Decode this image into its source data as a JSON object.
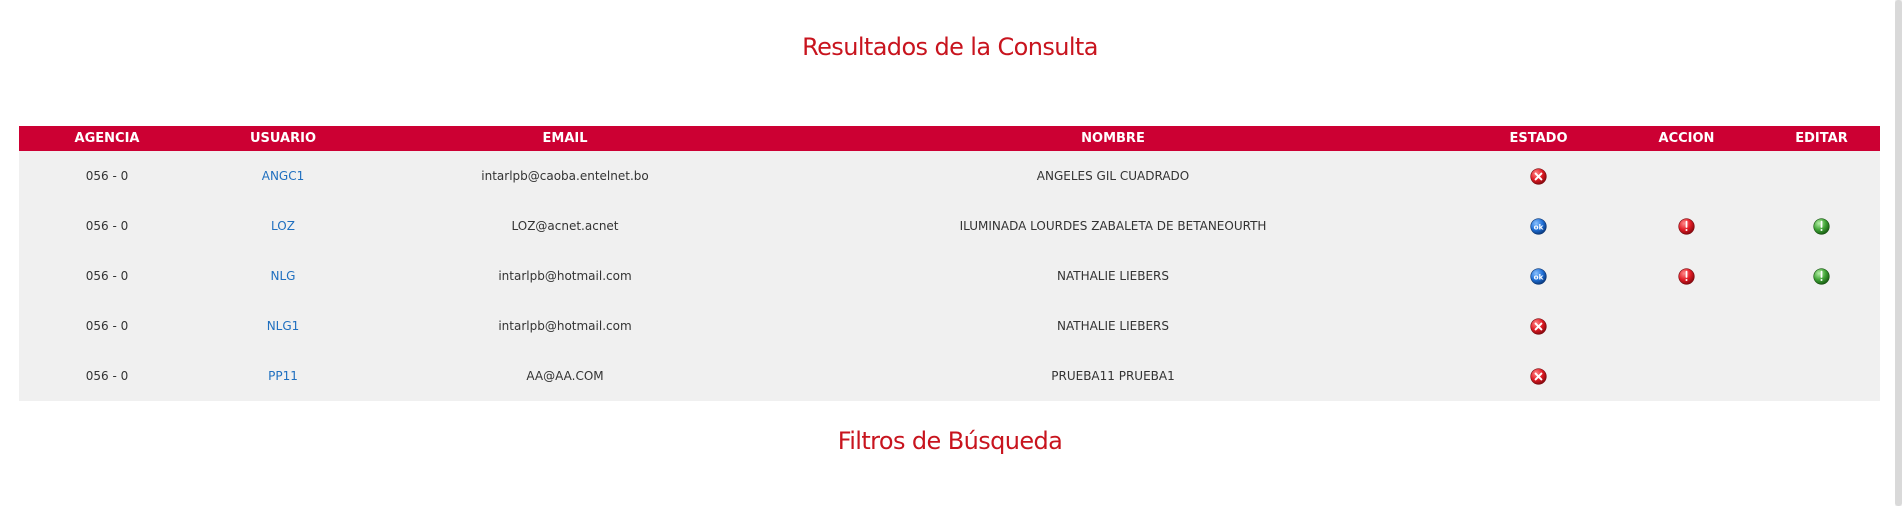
{
  "page": {
    "title": "Resultados de la Consulta",
    "filters_title": "Filtros de Búsqueda"
  },
  "colors": {
    "accent": "#cc0033",
    "title": "#c8141e",
    "link": "#1f6fbf",
    "row_bg": "#f0f0f0"
  },
  "table": {
    "headers": {
      "agencia": "AGENCIA",
      "usuario": "USUARIO",
      "email": "EMAIL",
      "nombre": "NOMBRE",
      "estado": "ESTADO",
      "accion": "ACCION",
      "editar": "EDITAR"
    },
    "rows": [
      {
        "agencia": "056 - 0",
        "usuario": "ANGC1",
        "email": "intarlpb@caoba.entelnet.bo",
        "nombre": "ANGELES GIL CUADRADO",
        "estado_icon": "inactive-x-icon",
        "accion_icon": "",
        "editar_icon": ""
      },
      {
        "agencia": "056 - 0",
        "usuario": "LOZ",
        "email": "LOZ@acnet.acnet",
        "nombre": "ILUMINADA LOURDES ZABALETA DE BETANEOURTH",
        "estado_icon": "ok-icon",
        "accion_icon": "power-off-icon",
        "editar_icon": "power-on-icon"
      },
      {
        "agencia": "056 - 0",
        "usuario": "NLG",
        "email": "intarlpb@hotmail.com",
        "nombre": "NATHALIE LIEBERS",
        "estado_icon": "ok-icon",
        "accion_icon": "power-off-icon",
        "editar_icon": "power-on-icon"
      },
      {
        "agencia": "056 - 0",
        "usuario": "NLG1",
        "email": "intarlpb@hotmail.com",
        "nombre": "NATHALIE LIEBERS",
        "estado_icon": "inactive-x-icon",
        "accion_icon": "",
        "editar_icon": ""
      },
      {
        "agencia": "056 - 0",
        "usuario": "PP11",
        "email": "AA@AA.COM",
        "nombre": "PRUEBA11 PRUEBA1",
        "estado_icon": "inactive-x-icon",
        "accion_icon": "",
        "editar_icon": ""
      }
    ]
  }
}
